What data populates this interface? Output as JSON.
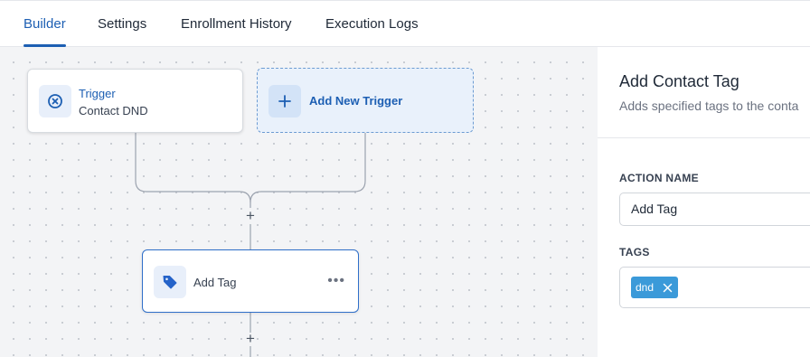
{
  "tabs": [
    {
      "label": "Builder",
      "active": true
    },
    {
      "label": "Settings",
      "active": false
    },
    {
      "label": "Enrollment History",
      "active": false
    },
    {
      "label": "Execution Logs",
      "active": false
    }
  ],
  "canvas": {
    "trigger_node": {
      "title": "Trigger",
      "subtitle": "Contact DND",
      "icon": "circle-x-icon"
    },
    "add_trigger_node": {
      "label": "Add New Trigger",
      "icon": "plus-icon"
    },
    "action_node": {
      "label": "Add Tag",
      "icon": "tag-icon",
      "menu_icon": "ellipsis-icon"
    },
    "add_step_symbol": "+"
  },
  "panel": {
    "title": "Add Contact Tag",
    "description": "Adds specified tags to the conta",
    "action_name_label": "ACTION NAME",
    "action_name_value": "Add Tag",
    "tags_label": "TAGS",
    "tags": [
      {
        "label": "dnd"
      }
    ]
  },
  "colors": {
    "accent": "#1d5fb3",
    "canvas_bg": "#f3f4f6",
    "tag_chip": "#3b9ad9"
  }
}
